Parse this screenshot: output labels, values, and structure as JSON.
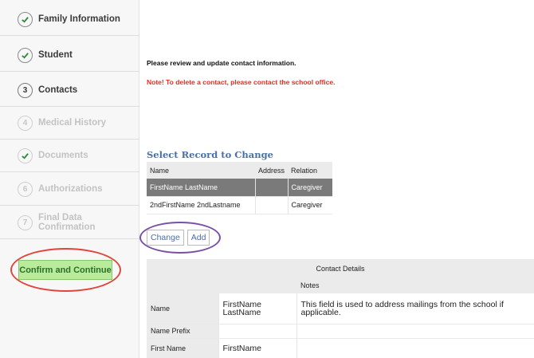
{
  "sidebar": {
    "steps": [
      {
        "label": "Family Information",
        "badge": ""
      },
      {
        "label": "Student",
        "badge": ""
      },
      {
        "label": "Contacts",
        "badge": "3"
      },
      {
        "label": "Medical History",
        "badge": "4"
      },
      {
        "label": "Documents",
        "badge": ""
      },
      {
        "label": "Authorizations",
        "badge": "6"
      },
      {
        "label": "Final Data Confirmation",
        "badge": "7"
      }
    ],
    "confirm_label": "Confirm and Continue"
  },
  "main": {
    "intro": "Please review and update contact information.",
    "note": "Note! To delete a contact, please contact the school office.",
    "select_title": "Select Record to Change",
    "records": {
      "columns": [
        "Name",
        "Address",
        "Relation"
      ],
      "rows": [
        {
          "name": "FirstName LastName",
          "address": "",
          "relation": "Caregiver"
        },
        {
          "name": "2ndFirstName 2ndLastname",
          "address": "",
          "relation": "Caregiver"
        }
      ]
    },
    "actions": {
      "change": "Change",
      "add": "Add"
    },
    "details": {
      "title": "Contact Details",
      "notes_header": "Notes",
      "rows": [
        {
          "label": "Name",
          "value": "FirstName LastName",
          "note": "This field is used to address mailings from the school if applicable."
        },
        {
          "label": "Name Prefix",
          "value": "",
          "note": ""
        },
        {
          "label": "First Name",
          "value": "FirstName",
          "note": ""
        }
      ]
    }
  }
}
